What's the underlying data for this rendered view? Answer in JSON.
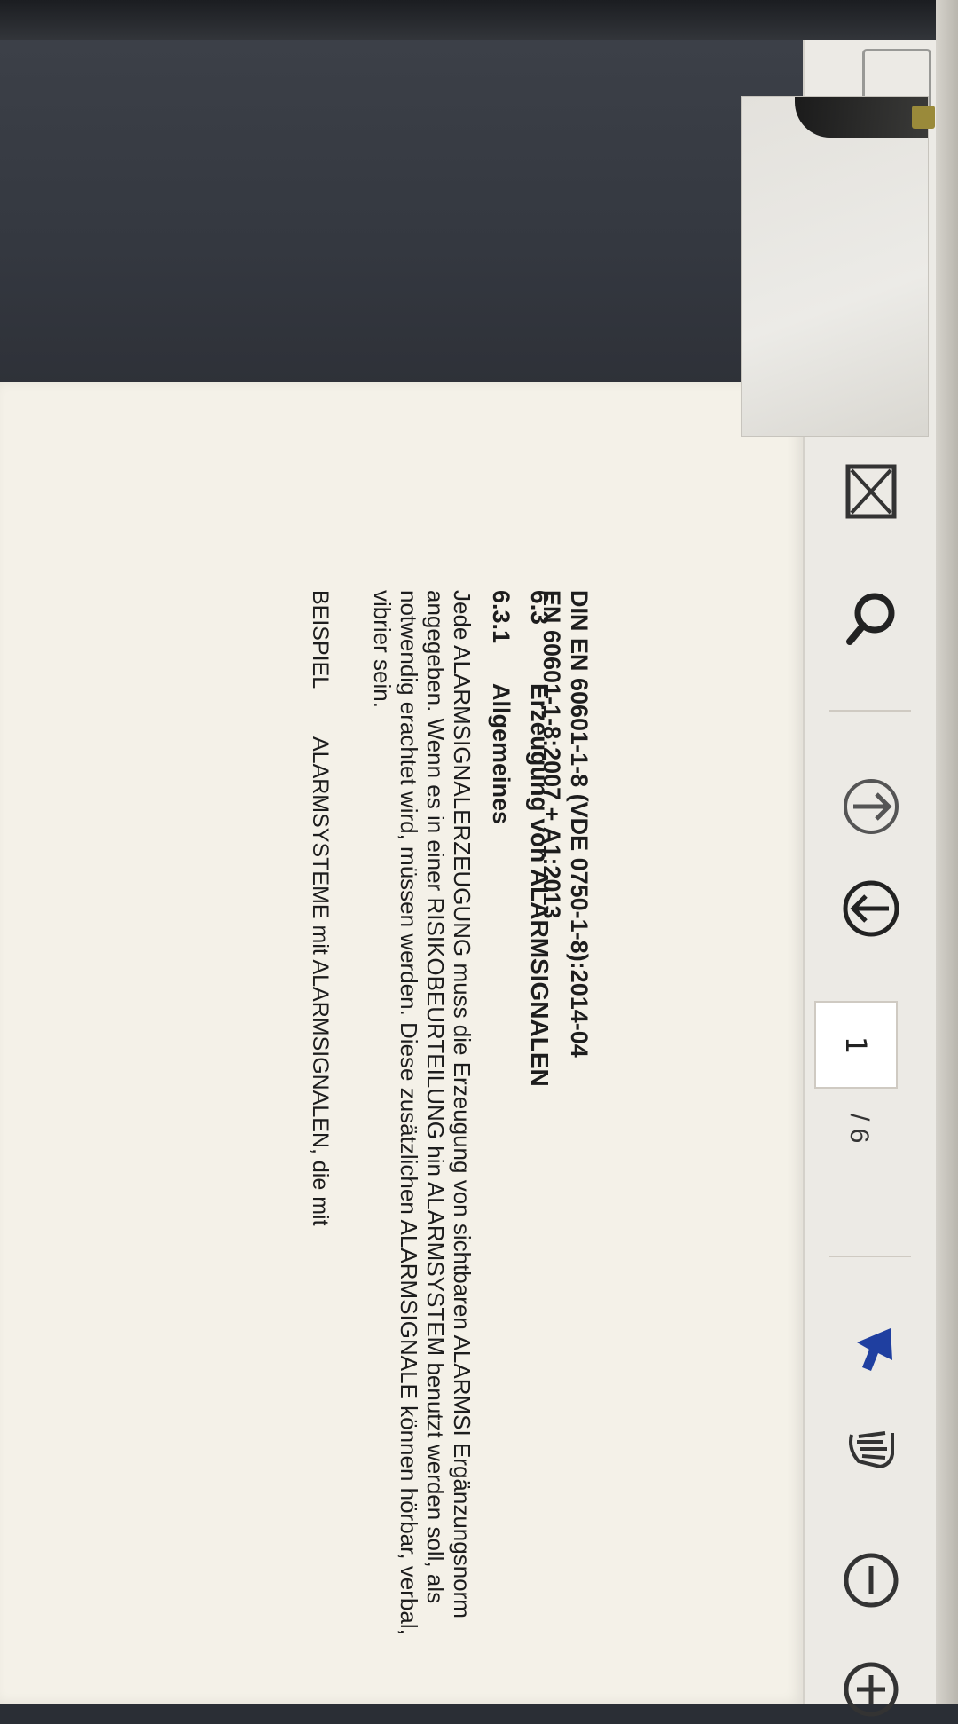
{
  "document": {
    "header_line1": "DIN EN 60601-1-8 (VDE 0750-1-8):2014-04",
    "header_line2": "EN 60601-1-8:2007 + A1:2013",
    "section_63_number": "6.3",
    "section_63_title": "Erzeugung von ALARMSIGNALEN",
    "section_631_number": "6.3.1",
    "section_631_title": "Allgemeines",
    "paragraph": "Jede ALARMSIGNALERZEUGUNG muss die Erzeugung von sichtbaren ALARMSI Ergänzungsnorm angegeben. Wenn es in einer RISIKOBEURTEILUNG hin ALARMSYSTEM benutzt werden soll, als notwendig erachtet wird, müssen werden. Diese zusätzlichen ALARMSIGNALE können hörbar, verbal, vibrier sein.",
    "example_label": "BEISPIEL",
    "example_text": "ALARMSYSTEME mit ALARMSIGNALEN, die mit"
  },
  "toolbar": {
    "page_current": "1",
    "page_total": "/ 6",
    "icons": [
      "close-box-icon",
      "search-icon",
      "page-up-icon",
      "page-down-icon",
      "select-cursor-icon",
      "hand-tool-icon",
      "zoom-out-icon",
      "zoom-in-icon"
    ],
    "accent_color": "#1f3fa0"
  }
}
